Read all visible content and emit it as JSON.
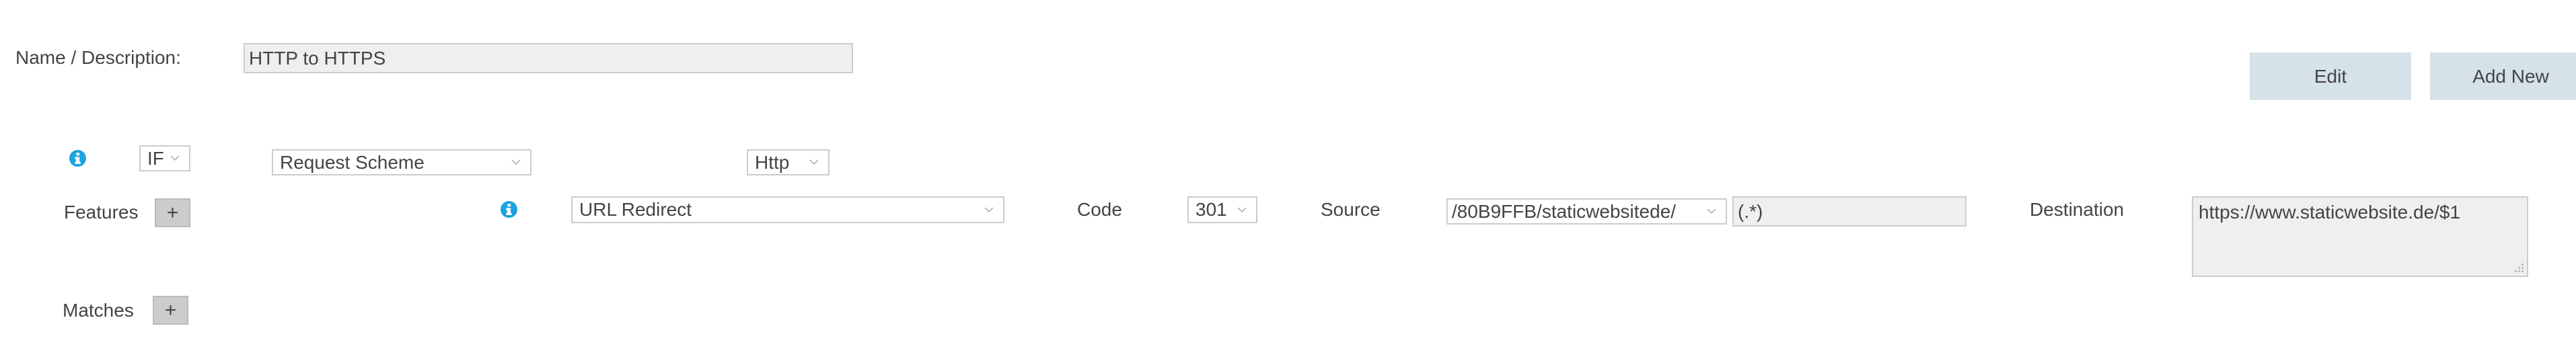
{
  "header": {
    "name_label": "Name / Description:",
    "name_value": "HTTP to HTTPS",
    "edit_label": "Edit",
    "add_new_label": "Add New"
  },
  "condition": {
    "info_icon": "info-icon",
    "operator": "IF",
    "variable": "Request Scheme",
    "value": "Http"
  },
  "features": {
    "label": "Features",
    "add_label": "+",
    "info_icon": "info-icon",
    "action": "URL Redirect",
    "code_label": "Code",
    "code_value": "301",
    "source_label": "Source",
    "source_path": "/80B9FFB/staticwebsitede/",
    "source_pattern": "(.*)",
    "destination_label": "Destination",
    "destination_value": "https://www.staticwebsite.de/$1"
  },
  "matches": {
    "label": "Matches",
    "add_label": "+"
  },
  "colors": {
    "accent_info": "#1aa3e0",
    "button_bg": "#d6e2ea",
    "input_readonly_bg": "#efefef",
    "border": "#cccccc",
    "text": "#444444"
  }
}
